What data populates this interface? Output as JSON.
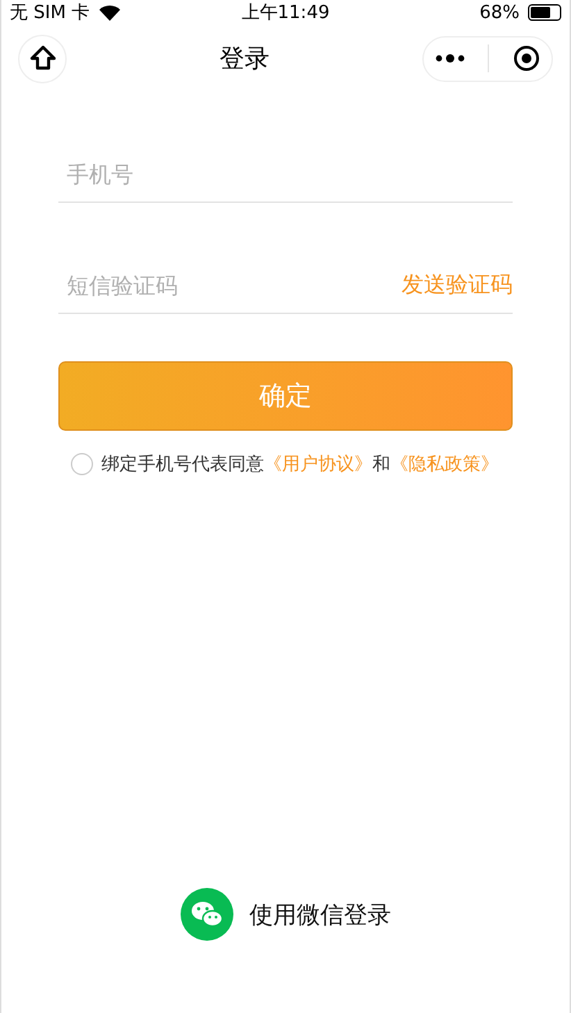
{
  "status_bar": {
    "carrier": "无 SIM 卡",
    "time": "上午11:49",
    "battery": "68%"
  },
  "nav_bar": {
    "title": "登录"
  },
  "form": {
    "phone": {
      "placeholder": "手机号"
    },
    "code": {
      "placeholder": "短信验证码",
      "action": "发送验证码"
    },
    "submit": "确定",
    "agreement": {
      "checked": false,
      "text": "绑定手机号代表同意",
      "link_1": "《用户协议》",
      "joiner": "和",
      "link_2": "《隐私政策》"
    }
  },
  "wechat_login": {
    "label": "使用微信登录"
  }
}
